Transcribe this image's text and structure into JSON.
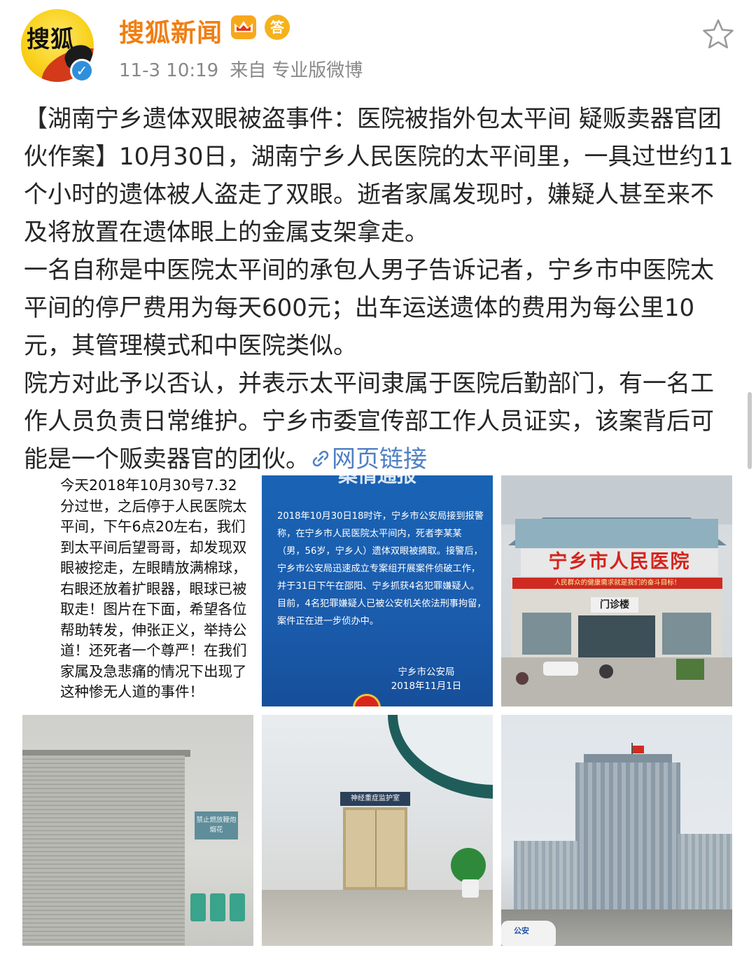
{
  "header": {
    "username": "搜狐新闻",
    "avatar_text": "搜狐",
    "badge_answer": "答",
    "time": "11-3 10:19",
    "source_prefix": "来自",
    "source": "专业版微博"
  },
  "post": {
    "paragraph1": "【湖南宁乡遗体双眼被盗事件：医院被指外包太平间 疑贩卖器官团伙作案】10月30日，湖南宁乡人民医院的太平间里，一具过世约11个小时的遗体被人盗走了双眼。逝者家属发现时，嫌疑人甚至来不及将放置在遗体眼上的金属支架拿走。",
    "paragraph2": "一名自称是中医院太平间的承包人男子告诉记者，宁乡市中医院太平间的停尸费用为每天600元；出车运送遗体的费用为每公里10元，其管理模式和中医院类似。",
    "paragraph3": "院方对此予以否认，并表示太平间隶属于医院后勤部门，有一名工作人员负责日常维护。宁乡市委宣传部工作人员证实，该案背后可能是一个贩卖器官的团伙。",
    "link_label": "网页链接"
  },
  "images": {
    "img1_text": "今天2018年10月30号7.32分过世，之后停于人民医院太平间，下午6点20左右，我们到太平间后望哥哥，却发现双眼被挖走，左眼睛放满棉球，右眼还放着扩眼器，眼球已被取走！图片在下面，希望各位帮助转发，伸张正义，举持公道！还死者一个尊严！在我们家属及急悲痛的情况下出现了这种惨无人道的事件！",
    "img2_heading": "案情通报",
    "img2_text": "2018年10月30日18时许，宁乡市公安局接到报警称，在宁乡市人民医院太平间内，死者李某某（男，56岁，宁乡人）遗体双眼被摘取。接警后，宁乡市公安局迅速成立专案组开展案件侦破工作，并于31日下午在邵阳、宁乡抓获4名犯罪嫌疑人。目前，4名犯罪嫌疑人已被公安机关依法刑事拘留，案件正在进一步侦办中。",
    "img2_signer": "宁乡市公安局",
    "img2_date": "2018年11月1日",
    "img3_sign": "宁乡市人民医院",
    "img3_banner": "人民群众的健康需求就是我们的奋斗目标！",
    "img3_door": "门诊楼",
    "img4_plaque": "禁止燃放鞭炮烟花",
    "img5_lintel": "神经重症监护室",
    "img6_car": "公安"
  },
  "colors": {
    "username": "#f07e12",
    "link": "#4f80c3",
    "meta": "#888888",
    "verify": "#2f8fdb"
  },
  "icons": [
    "star-icon",
    "verified-icon",
    "crown-badge-icon",
    "answer-badge-icon",
    "link-icon"
  ]
}
